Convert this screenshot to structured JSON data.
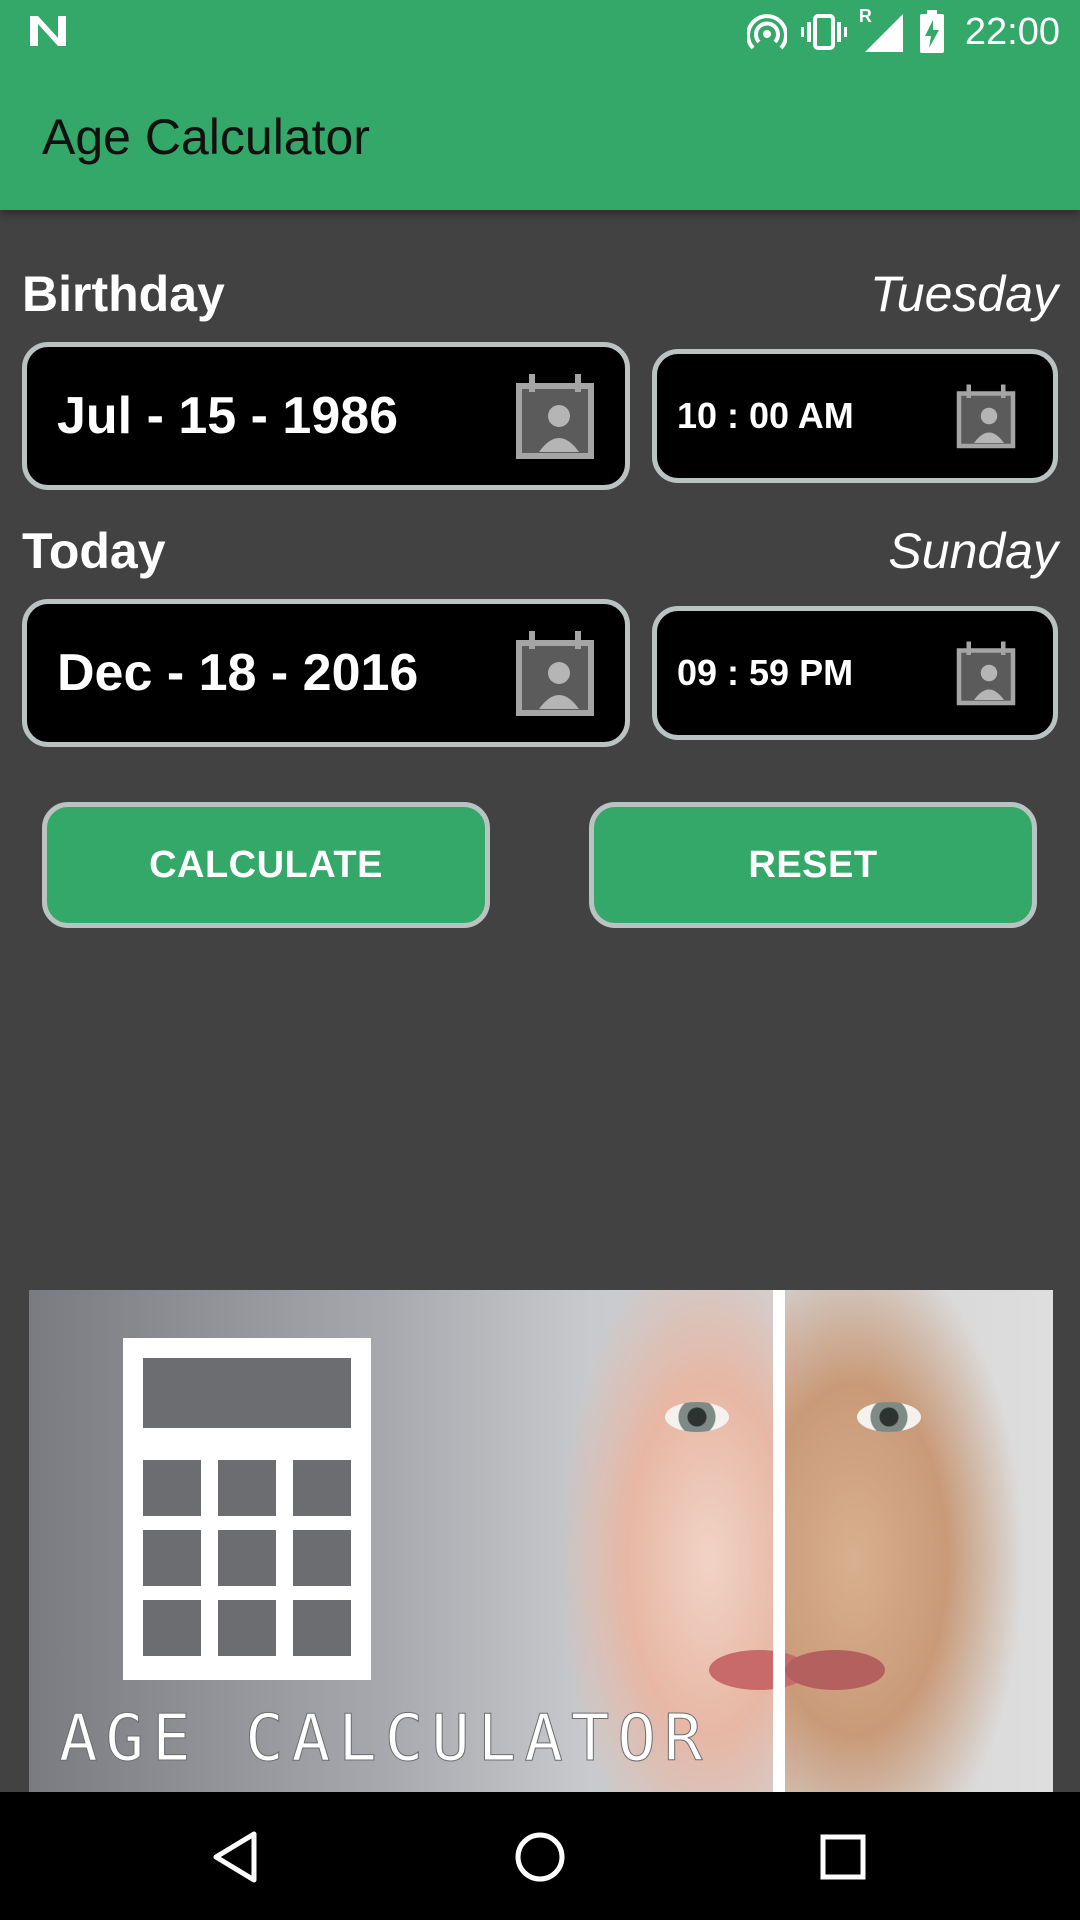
{
  "status_bar": {
    "time": "22:00",
    "icons": [
      "n-logo-icon",
      "hotspot-icon",
      "vibrate-icon",
      "signal-icon",
      "battery-charging-icon"
    ],
    "signal_label": "R"
  },
  "app_bar": {
    "title": "Age Calculator"
  },
  "birthday": {
    "label": "Birthday",
    "weekday": "Tuesday",
    "date": "Jul - 15 - 1986",
    "time": "10 : 00 AM"
  },
  "today": {
    "label": "Today",
    "weekday": "Sunday",
    "date": "Dec - 18 - 2016",
    "time": "09 : 59 PM"
  },
  "buttons": {
    "calculate": "CALCULATE",
    "reset": "RESET"
  },
  "banner": {
    "title": "AGE CALCULATOR"
  },
  "nav": {
    "icons": [
      "back-icon",
      "home-icon",
      "recents-icon"
    ]
  },
  "colors": {
    "accent": "#34a868",
    "background": "#424242",
    "field_border": "#b9c3c1"
  }
}
